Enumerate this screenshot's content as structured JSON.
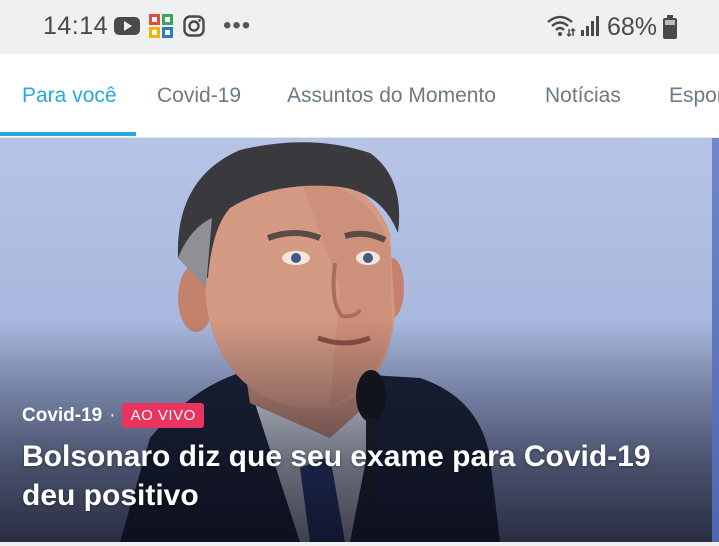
{
  "status_bar": {
    "time": "14:14",
    "battery": "68%",
    "more": "•••",
    "icons": [
      "youtube-icon",
      "app-icon",
      "instagram-icon",
      "more-icon",
      "wifi-icon",
      "signal-icon",
      "battery-icon"
    ]
  },
  "tabs": [
    {
      "label": "Para você",
      "active": true
    },
    {
      "label": "Covid-19"
    },
    {
      "label": "Assuntos do Momento"
    },
    {
      "label": "Notícias"
    },
    {
      "label": "Espor"
    }
  ],
  "hero": {
    "category": "Covid-19",
    "separator": "·",
    "badge": "AO VIVO",
    "title": "Bolsonaro diz que seu exame para Covid-19 deu positivo"
  },
  "colors": {
    "accent": "#2aa8de",
    "live_badge": "#e8345e",
    "tab_text": "#6b7a86",
    "status_bg": "#eef0f2"
  }
}
